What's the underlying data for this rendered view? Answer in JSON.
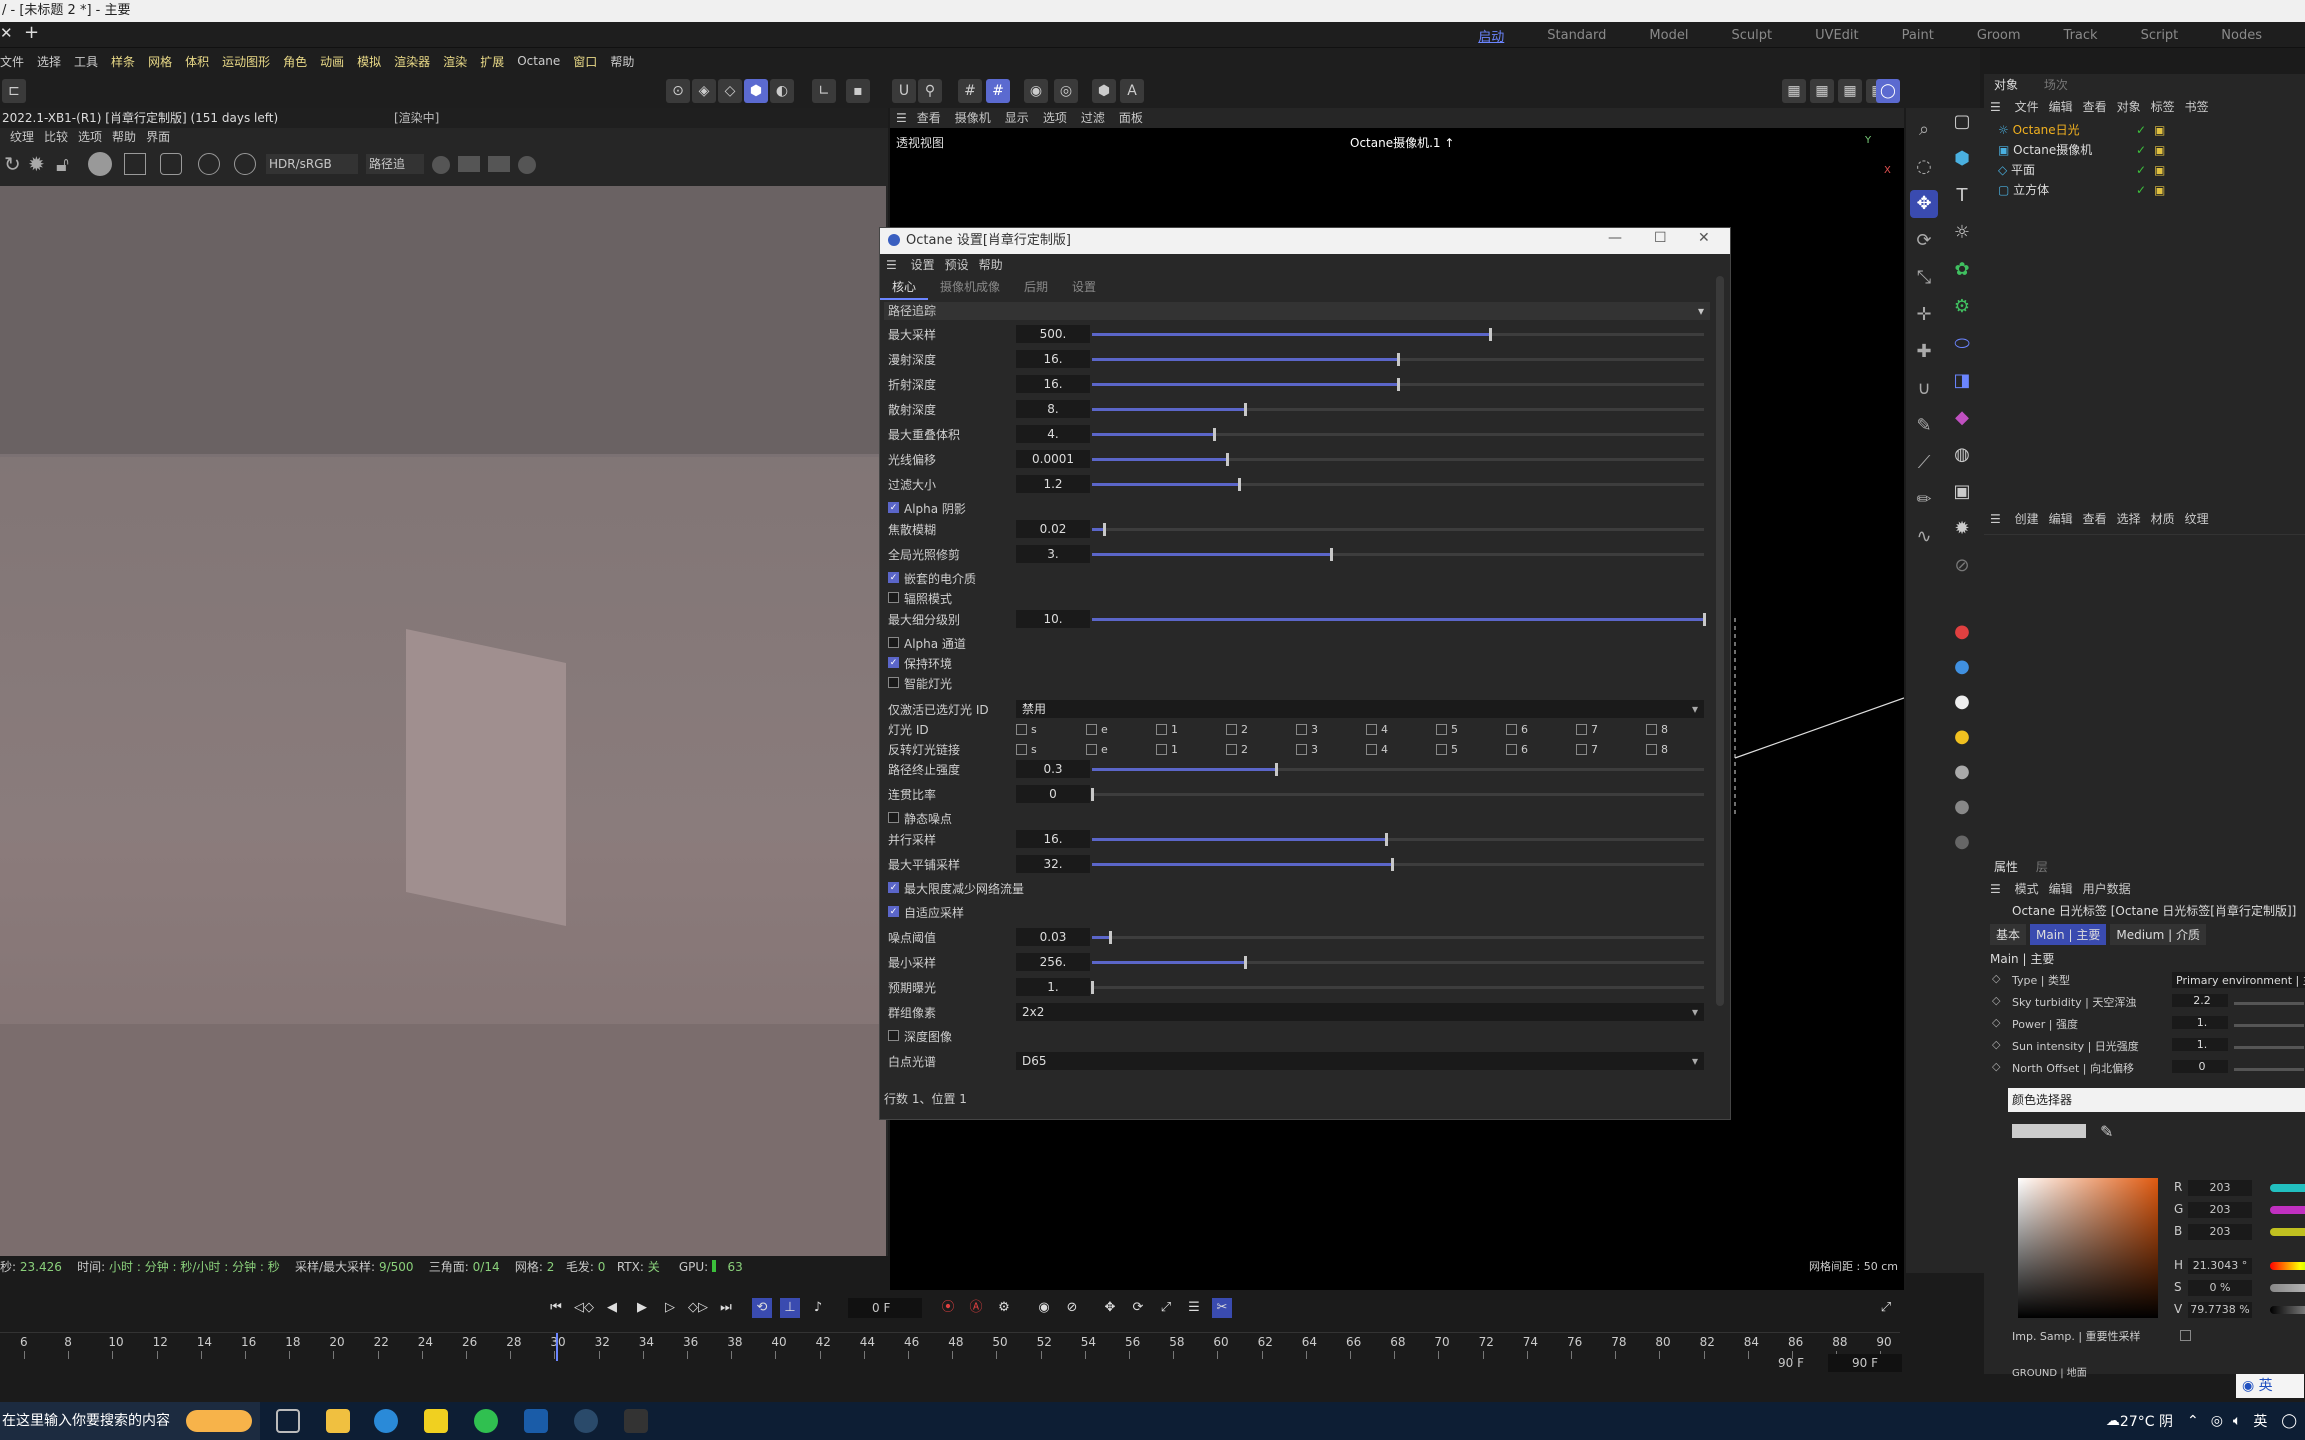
{
  "window": {
    "title": "/ - [未标题 2 *] - 主要",
    "close": "✕",
    "new_tab": "+"
  },
  "layouts": [
    "启动",
    "Standard",
    "Model",
    "Sculpt",
    "UVEdit",
    "Paint",
    "Groom",
    "Track",
    "Script",
    "Nodes"
  ],
  "menubar": [
    {
      "label": "文件",
      "y": false
    },
    {
      "label": "选择",
      "y": false
    },
    {
      "label": "工具",
      "y": false
    },
    {
      "label": "样条",
      "y": true
    },
    {
      "label": "网格",
      "y": true
    },
    {
      "label": "体积",
      "y": true
    },
    {
      "label": "运动图形",
      "y": true
    },
    {
      "label": "角色",
      "y": true
    },
    {
      "label": "动画",
      "y": true
    },
    {
      "label": "模拟",
      "y": true
    },
    {
      "label": "渲染器",
      "y": true
    },
    {
      "label": "渲染",
      "y": true
    },
    {
      "label": "扩展",
      "y": true
    },
    {
      "label": "Octane",
      "y": false
    },
    {
      "label": "窗口",
      "y": true
    },
    {
      "label": "帮助",
      "y": false
    }
  ],
  "live_viewer": {
    "header": "2022.1-XB1-(R1) [肖章行定制版]  (151 days left)",
    "render_state": "[渲染中]",
    "menu": [
      "纹理",
      "比较",
      "选项",
      "帮助",
      "界面"
    ],
    "colorspace": "HDR/sRGB",
    "mode": "路径追"
  },
  "status": {
    "time_label": "秒:",
    "time": "23.426",
    "clock_label": "时间:",
    "clock": "小时 : 分钟 : 秒/小时 : 分钟 : 秒",
    "spp_label": "采样/最大采样:",
    "spp": "9/500",
    "tris_label": "三角面:",
    "tris": "0/14",
    "mesh_label": "网格:",
    "mesh": "2",
    "hair_label": "毛发:",
    "hair": "0",
    "rtx_label": "RTX:",
    "rtx": "关",
    "gpu_label": "GPU:",
    "gpu": "63"
  },
  "viewport": {
    "menu": [
      "查看",
      "摄像机",
      "显示",
      "选项",
      "过滤",
      "面板"
    ],
    "label": "透视视图",
    "camera": "Octane摄像机.1 ↑",
    "grid": "网格间距 : 50 cm"
  },
  "objects": {
    "tabs": [
      "对象",
      "场次"
    ],
    "menu": [
      "文件",
      "编辑",
      "查看",
      "对象",
      "标签",
      "书签"
    ],
    "items": [
      "Octane日光",
      "Octane摄像机",
      "平面",
      "立方体"
    ]
  },
  "materials": {
    "menu": [
      "创建",
      "编辑",
      "查看",
      "选择",
      "材质",
      "纹理"
    ]
  },
  "attributes": {
    "tabs": [
      "属性",
      "层"
    ],
    "menu": [
      "模式",
      "编辑",
      "用户数据"
    ],
    "title": "Octane 日光标签 [Octane 日光标签[肖章行定制版]]",
    "subtabs": [
      "基本",
      "Main | 主要",
      "Medium | 介质"
    ],
    "section": "Main | 主要",
    "rows": [
      {
        "label": "Type | 类型",
        "value": "Primary environment | 主"
      },
      {
        "label": "Sky turbidity | 天空浑浊",
        "value": "2.2"
      },
      {
        "label": "Power | 强度",
        "value": "1."
      },
      {
        "label": "Sun intensity | 日光强度",
        "value": "1."
      },
      {
        "label": "North Offset | 向北偏移",
        "value": "0"
      }
    ],
    "imp_samp": "Imp. Samp. | 重要性采样",
    "ground": "GROUND | 地面"
  },
  "color_picker": {
    "title": "颜色选择器",
    "R": "203",
    "G": "203",
    "B": "203",
    "H": "21.3043 °",
    "S": "0 %",
    "V": "79.7738 %"
  },
  "dialog": {
    "title": "Octane 设置[肖章行定制版]",
    "menu": [
      "设置",
      "预设",
      "帮助"
    ],
    "tabs": [
      "核心",
      "摄像机成像",
      "后期",
      "设置"
    ],
    "section": "路径追踪",
    "footer": "行数 1、位置 1",
    "rows": [
      {
        "t": "slider",
        "label": "最大采样",
        "value": "500.",
        "frac": 0.65
      },
      {
        "t": "slider",
        "label": "漫射深度",
        "value": "16.",
        "frac": 0.5
      },
      {
        "t": "slider",
        "label": "折射深度",
        "value": "16.",
        "frac": 0.5
      },
      {
        "t": "slider",
        "label": "散射深度",
        "value": "8.",
        "frac": 0.25
      },
      {
        "t": "slider",
        "label": "最大重叠体积",
        "value": "4.",
        "frac": 0.2
      },
      {
        "t": "slider",
        "label": "光线偏移",
        "value": "0.0001",
        "frac": 0.22
      },
      {
        "t": "slider",
        "label": "过滤大小",
        "value": "1.2",
        "frac": 0.24
      },
      {
        "t": "check",
        "label": "Alpha 阴影",
        "on": true
      },
      {
        "t": "slider",
        "label": "焦散模糊",
        "value": "0.02",
        "frac": 0.02
      },
      {
        "t": "slider",
        "label": "全局光照修剪",
        "value": "3.",
        "frac": 0.39
      },
      {
        "t": "check",
        "label": "嵌套的电介质",
        "on": true
      },
      {
        "t": "check",
        "label": "辐照模式",
        "on": false
      },
      {
        "t": "slider",
        "label": "最大细分级别",
        "value": "10.",
        "frac": 1.0
      },
      {
        "t": "check",
        "label": "Alpha 通道",
        "on": false
      },
      {
        "t": "check",
        "label": "保持环境",
        "on": true
      },
      {
        "t": "check",
        "label": "智能灯光",
        "on": false
      },
      {
        "t": "dropdown",
        "label": "仅激活已选灯光 ID",
        "value": "禁用"
      },
      {
        "t": "lightids",
        "label": "灯光 ID"
      },
      {
        "t": "lightids",
        "label": "反转灯光链接"
      },
      {
        "t": "slider",
        "label": "路径终止强度",
        "value": "0.3",
        "frac": 0.3
      },
      {
        "t": "slider",
        "label": "连贯比率",
        "value": "0",
        "frac": 0.0
      },
      {
        "t": "check",
        "label": "静态噪点",
        "on": false
      },
      {
        "t": "slider",
        "label": "并行采样",
        "value": "16.",
        "frac": 0.48
      },
      {
        "t": "slider",
        "label": "最大平铺采样",
        "value": "32.",
        "frac": 0.49
      },
      {
        "t": "check",
        "label": "最大限度减少网络流量",
        "on": true
      },
      {
        "t": "check",
        "label": "自适应采样",
        "on": true
      },
      {
        "t": "slider",
        "label": "噪点阈值",
        "value": "0.03",
        "frac": 0.03
      },
      {
        "t": "slider",
        "label": "最小采样",
        "value": "256.",
        "frac": 0.25
      },
      {
        "t": "slider",
        "label": "预期曝光",
        "value": "1.",
        "frac": 0.0
      },
      {
        "t": "dropdown",
        "label": "群组像素",
        "value": "2x2"
      },
      {
        "t": "check",
        "label": "深度图像",
        "on": false
      },
      {
        "t": "dropdown",
        "label": "白点光谱",
        "value": "D65"
      }
    ],
    "light_ids": [
      "s",
      "e",
      "1",
      "2",
      "3",
      "4",
      "5",
      "6",
      "7",
      "8"
    ]
  },
  "timeline": {
    "frame": "0 F",
    "end1": "90 F",
    "end2": "90 F",
    "ticks": [
      "6",
      "8",
      "10",
      "12",
      "14",
      "16",
      "18",
      "20",
      "22",
      "24",
      "26",
      "28",
      "30",
      "32",
      "34",
      "36",
      "38",
      "40",
      "42",
      "44",
      "46",
      "48",
      "50",
      "52",
      "54",
      "56",
      "58",
      "60",
      "62",
      "64",
      "66",
      "68",
      "70",
      "72",
      "74",
      "76",
      "78",
      "80",
      "82",
      "84",
      "86",
      "88",
      "90"
    ]
  },
  "taskbar": {
    "search": "在这里输入你要搜索的内容",
    "weather": "27°C 阴",
    "ime": "英",
    "ime_badge": "英"
  }
}
